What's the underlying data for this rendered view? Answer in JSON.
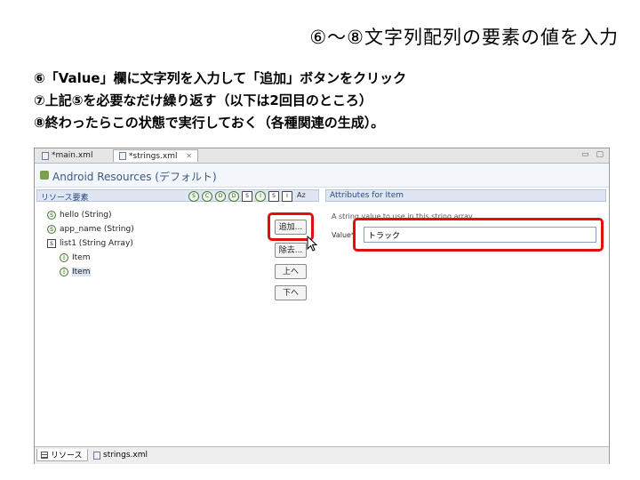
{
  "slide": {
    "title": "⑥～⑧文字列配列の要素の値を入力",
    "steps": [
      "⑥「Value」欄に文字列を入力して「追加」ボタンをクリック",
      "⑦上記⑤を必要なだけ繰り返す（以下は2回目のところ）",
      "⑧終わったらこの状態で実行しておく（各種関連の生成）。"
    ]
  },
  "editor": {
    "tabs": [
      {
        "label": "*main.xml"
      },
      {
        "label": "*strings.xml",
        "close": "✕"
      }
    ],
    "window_controls": [
      "▭",
      "▢"
    ],
    "resources_title": "Android Resources (デフォルト)",
    "left_panel_title": "リソース要素",
    "type_icons": [
      "S",
      "C",
      "D",
      "D",
      "S",
      "I",
      "S",
      "I"
    ],
    "sort_label": "Az",
    "tree": [
      {
        "icon": "S",
        "label": "hello (String)"
      },
      {
        "icon": "S",
        "label": "app_name (String)"
      },
      {
        "icon": "S",
        "label": "list1 (String Array)"
      },
      {
        "icon": "I",
        "label": "Item"
      },
      {
        "icon": "I",
        "label": "Item"
      }
    ],
    "buttons": {
      "add": "追加...",
      "remove": "除去...",
      "up": "上へ",
      "down": "下へ"
    },
    "right_panel_title": "Attributes for Item",
    "hint": "A string value to use in this string array.",
    "value_label": "Value*",
    "value_input": "トラック",
    "bottom_tabs": [
      {
        "label": "リソース"
      },
      {
        "label": "strings.xml"
      }
    ],
    "highlight_color": "#e01010"
  }
}
